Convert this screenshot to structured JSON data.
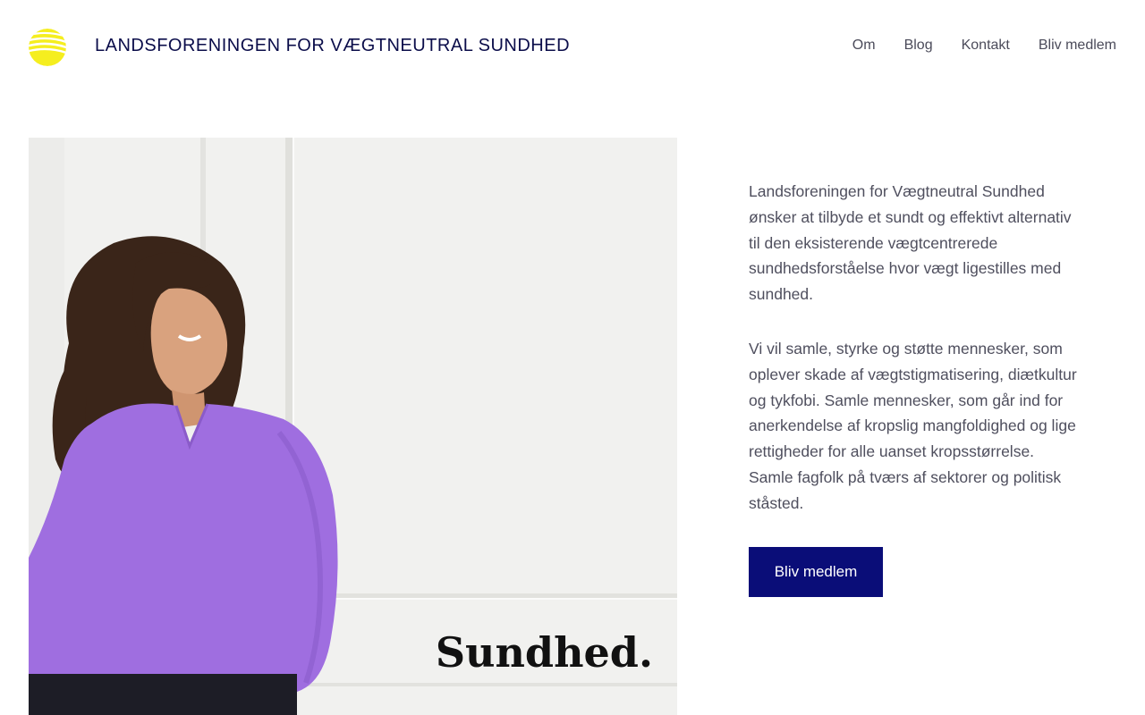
{
  "header": {
    "site_title": "LANDSFORENINGEN FOR VÆGTNEUTRAL SUNDHED",
    "nav": [
      {
        "label": "Om"
      },
      {
        "label": "Blog"
      },
      {
        "label": "Kontakt"
      },
      {
        "label": "Bliv medlem"
      }
    ]
  },
  "hero": {
    "image_text": "Sundhed.",
    "paragraphs": [
      "Landsforeningen for Vægtneutral Sundhed ønsker at tilbyde et sundt og effektivt alternativ til den eksisterende vægtcentrerede sundhedsforståelse hvor vægt ligestilles med sundhed.",
      "Vi vil samle, styrke og støtte mennesker, som oplever skade af vægtstigmatisering, diætkultur og tykfobi. Samle mennesker, som går ind for anerkendelse af kropslig mangfoldighed og lige rettigheder for alle uanset kropsstørrelse. Samle fagfolk på tværs af sektorer og politisk ståsted."
    ],
    "cta_label": "Bliv medlem"
  },
  "colors": {
    "logo": "#f5ee1f",
    "title": "#0b0d4a",
    "button": "#0a0d78",
    "sweater": "#9f6ee0"
  }
}
